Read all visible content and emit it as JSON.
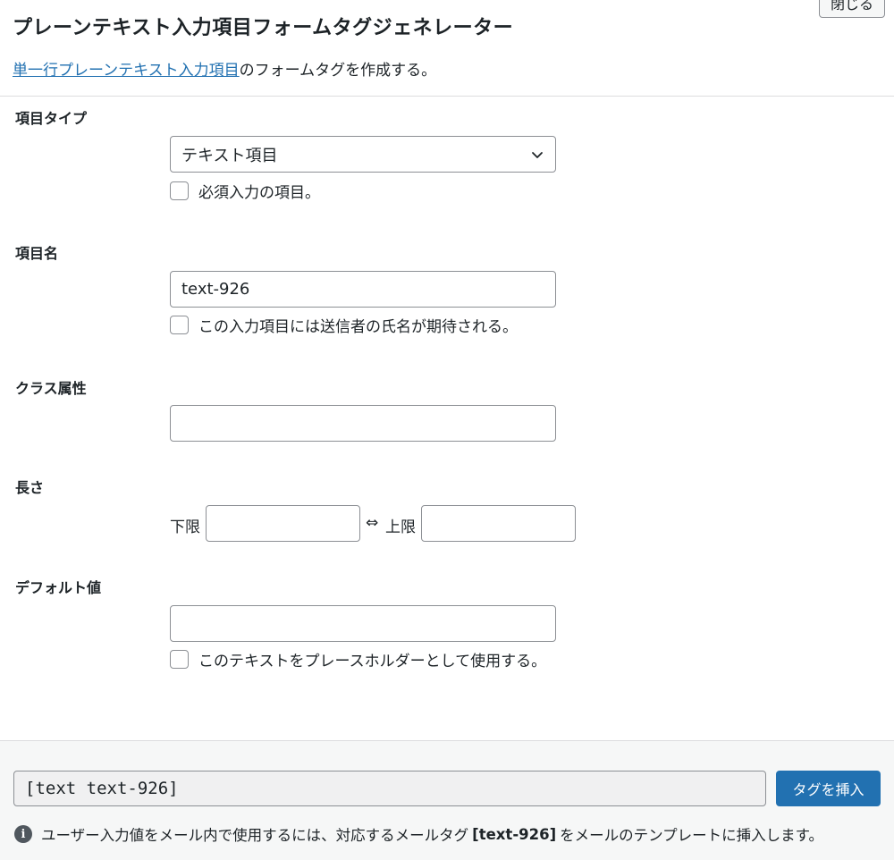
{
  "header": {
    "close_label": "閉じる",
    "title": "プレーンテキスト入力項目フォームタグジェネレーター",
    "desc_link": "単一行プレーンテキスト入力項目",
    "desc_rest": "のフォームタグを作成する。"
  },
  "fields": {
    "type": {
      "label": "項目タイプ",
      "selected": "テキスト項目",
      "required_label": "必須入力の項目。"
    },
    "name": {
      "label": "項目名",
      "value": "text-926",
      "sender_name_label": "この入力項目には送信者の氏名が期待される。"
    },
    "class": {
      "label": "クラス属性",
      "value": ""
    },
    "length": {
      "label": "長さ",
      "min_label": "下限",
      "arrow": "⇔",
      "max_label": "上限"
    },
    "default": {
      "label": "デフォルト値",
      "value": "",
      "placeholder_label": "このテキストをプレースホルダーとして使用する。"
    }
  },
  "footer": {
    "tag": "[text text-926]",
    "insert_label": "タグを挿入",
    "info_before": "ユーザー入力値をメール内で使用するには、対応するメールタグ",
    "info_tag": "[text-926]",
    "info_after": "をメールのテンプレートに挿入します。"
  },
  "colors": {
    "accent": "#2271b1",
    "link": "#2271b1",
    "text": "#1d2327",
    "border": "#8c8f94"
  }
}
